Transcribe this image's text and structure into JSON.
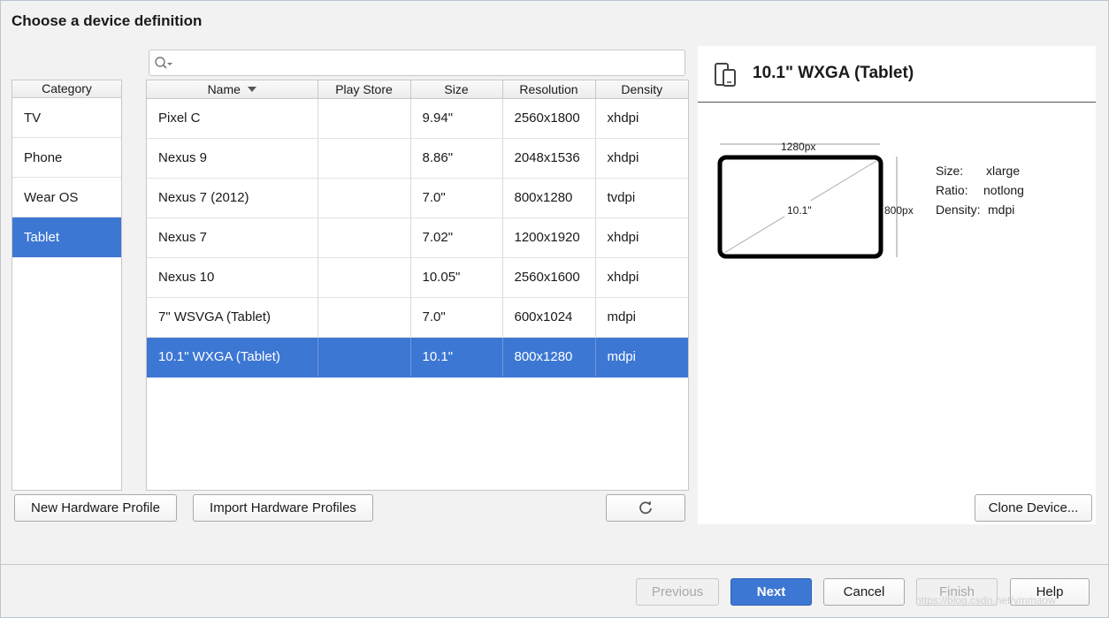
{
  "dialog": {
    "title": "Choose a device definition"
  },
  "search": {
    "value": "",
    "placeholder": ""
  },
  "category": {
    "header": "Category",
    "items": [
      {
        "label": "TV",
        "selected": false
      },
      {
        "label": "Phone",
        "selected": false
      },
      {
        "label": "Wear OS",
        "selected": false
      },
      {
        "label": "Tablet",
        "selected": true
      }
    ]
  },
  "devices": {
    "columns": [
      "Name",
      "Play Store",
      "Size",
      "Resolution",
      "Density"
    ],
    "rows": [
      {
        "name": "Pixel C",
        "play_store": "",
        "size": "9.94\"",
        "resolution": "2560x1800",
        "density": "xhdpi",
        "selected": false
      },
      {
        "name": "Nexus 9",
        "play_store": "",
        "size": "8.86\"",
        "resolution": "2048x1536",
        "density": "xhdpi",
        "selected": false
      },
      {
        "name": "Nexus 7 (2012)",
        "play_store": "",
        "size": "7.0\"",
        "resolution": "800x1280",
        "density": "tvdpi",
        "selected": false
      },
      {
        "name": "Nexus 7",
        "play_store": "",
        "size": "7.02\"",
        "resolution": "1200x1920",
        "density": "xhdpi",
        "selected": false
      },
      {
        "name": "Nexus 10",
        "play_store": "",
        "size": "10.05\"",
        "resolution": "2560x1600",
        "density": "xhdpi",
        "selected": false
      },
      {
        "name": "7\" WSVGA (Tablet)",
        "play_store": "",
        "size": "7.0\"",
        "resolution": "600x1024",
        "density": "mdpi",
        "selected": false
      },
      {
        "name": "10.1\" WXGA (Tablet)",
        "play_store": "",
        "size": "10.1\"",
        "resolution": "800x1280",
        "density": "mdpi",
        "selected": true
      }
    ]
  },
  "buttons": {
    "new_hardware_profile": "New Hardware Profile",
    "import_hardware_profiles": "Import Hardware Profiles",
    "refresh_icon": "refresh-icon",
    "clone_device": "Clone Device...",
    "previous": "Previous",
    "next": "Next",
    "cancel": "Cancel",
    "finish": "Finish",
    "help": "Help"
  },
  "preview": {
    "title": "10.1\" WXGA (Tablet)",
    "icon": "device-icon",
    "width_label": "1280px",
    "height_label": "800px",
    "diagonal_label": "10.1\"",
    "specs": [
      {
        "key": "Size:",
        "value": "xlarge"
      },
      {
        "key": "Ratio:",
        "value": "notlong"
      },
      {
        "key": "Density:",
        "value": "mdpi"
      }
    ]
  },
  "colors": {
    "selection": "#3d77d4",
    "primary_button": "#3d77d4"
  },
  "watermark": "https://blog.csdn.net/ymmaow"
}
